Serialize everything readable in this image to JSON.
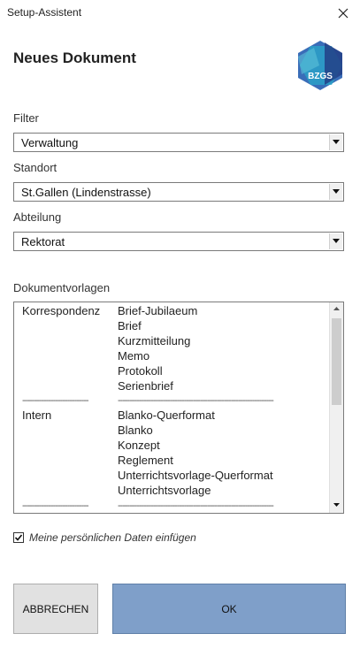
{
  "window": {
    "title": "Setup-Assistent",
    "heading": "Neues Dokument",
    "logo_text": "BZGS"
  },
  "form": {
    "filter": {
      "label": "Filter",
      "value": "Verwaltung"
    },
    "standort": {
      "label": "Standort",
      "value": "St.Gallen (Lindenstrasse)"
    },
    "abteilung": {
      "label": "Abteilung",
      "value": "Rektorat"
    }
  },
  "templates": {
    "label": "Dokumentvorlagen",
    "rows": [
      {
        "category": "Korrespondenz",
        "name": "Brief-Jubilaeum"
      },
      {
        "category": "",
        "name": "Brief"
      },
      {
        "category": "",
        "name": "Kurzmitteilung"
      },
      {
        "category": "",
        "name": "Memo"
      },
      {
        "category": "",
        "name": "Protokoll"
      },
      {
        "category": "",
        "name": "Serienbrief"
      },
      {
        "category": "----------------------------",
        "name": "------------------------------------------------------------------"
      },
      {
        "category": "Intern",
        "name": "Blanko-Querformat"
      },
      {
        "category": "",
        "name": "Blanko"
      },
      {
        "category": "",
        "name": "Konzept"
      },
      {
        "category": "",
        "name": "Reglement"
      },
      {
        "category": "",
        "name": "Unterrichtsvorlage-Querformat"
      },
      {
        "category": "",
        "name": "Unterrichtsvorlage"
      },
      {
        "category": "----------------------------",
        "name": "------------------------------------------------------------------"
      }
    ]
  },
  "options": {
    "personal_data_label": "Meine persönlichen Daten einfügen",
    "personal_data_checked": true
  },
  "buttons": {
    "cancel": "ABBRECHEN",
    "ok": "OK"
  },
  "colors": {
    "ok_button": "#7f9fc9",
    "cancel_button": "#e1e1e1",
    "logo_primary": "#2f5fa8",
    "logo_secondary": "#2aa7c9"
  }
}
